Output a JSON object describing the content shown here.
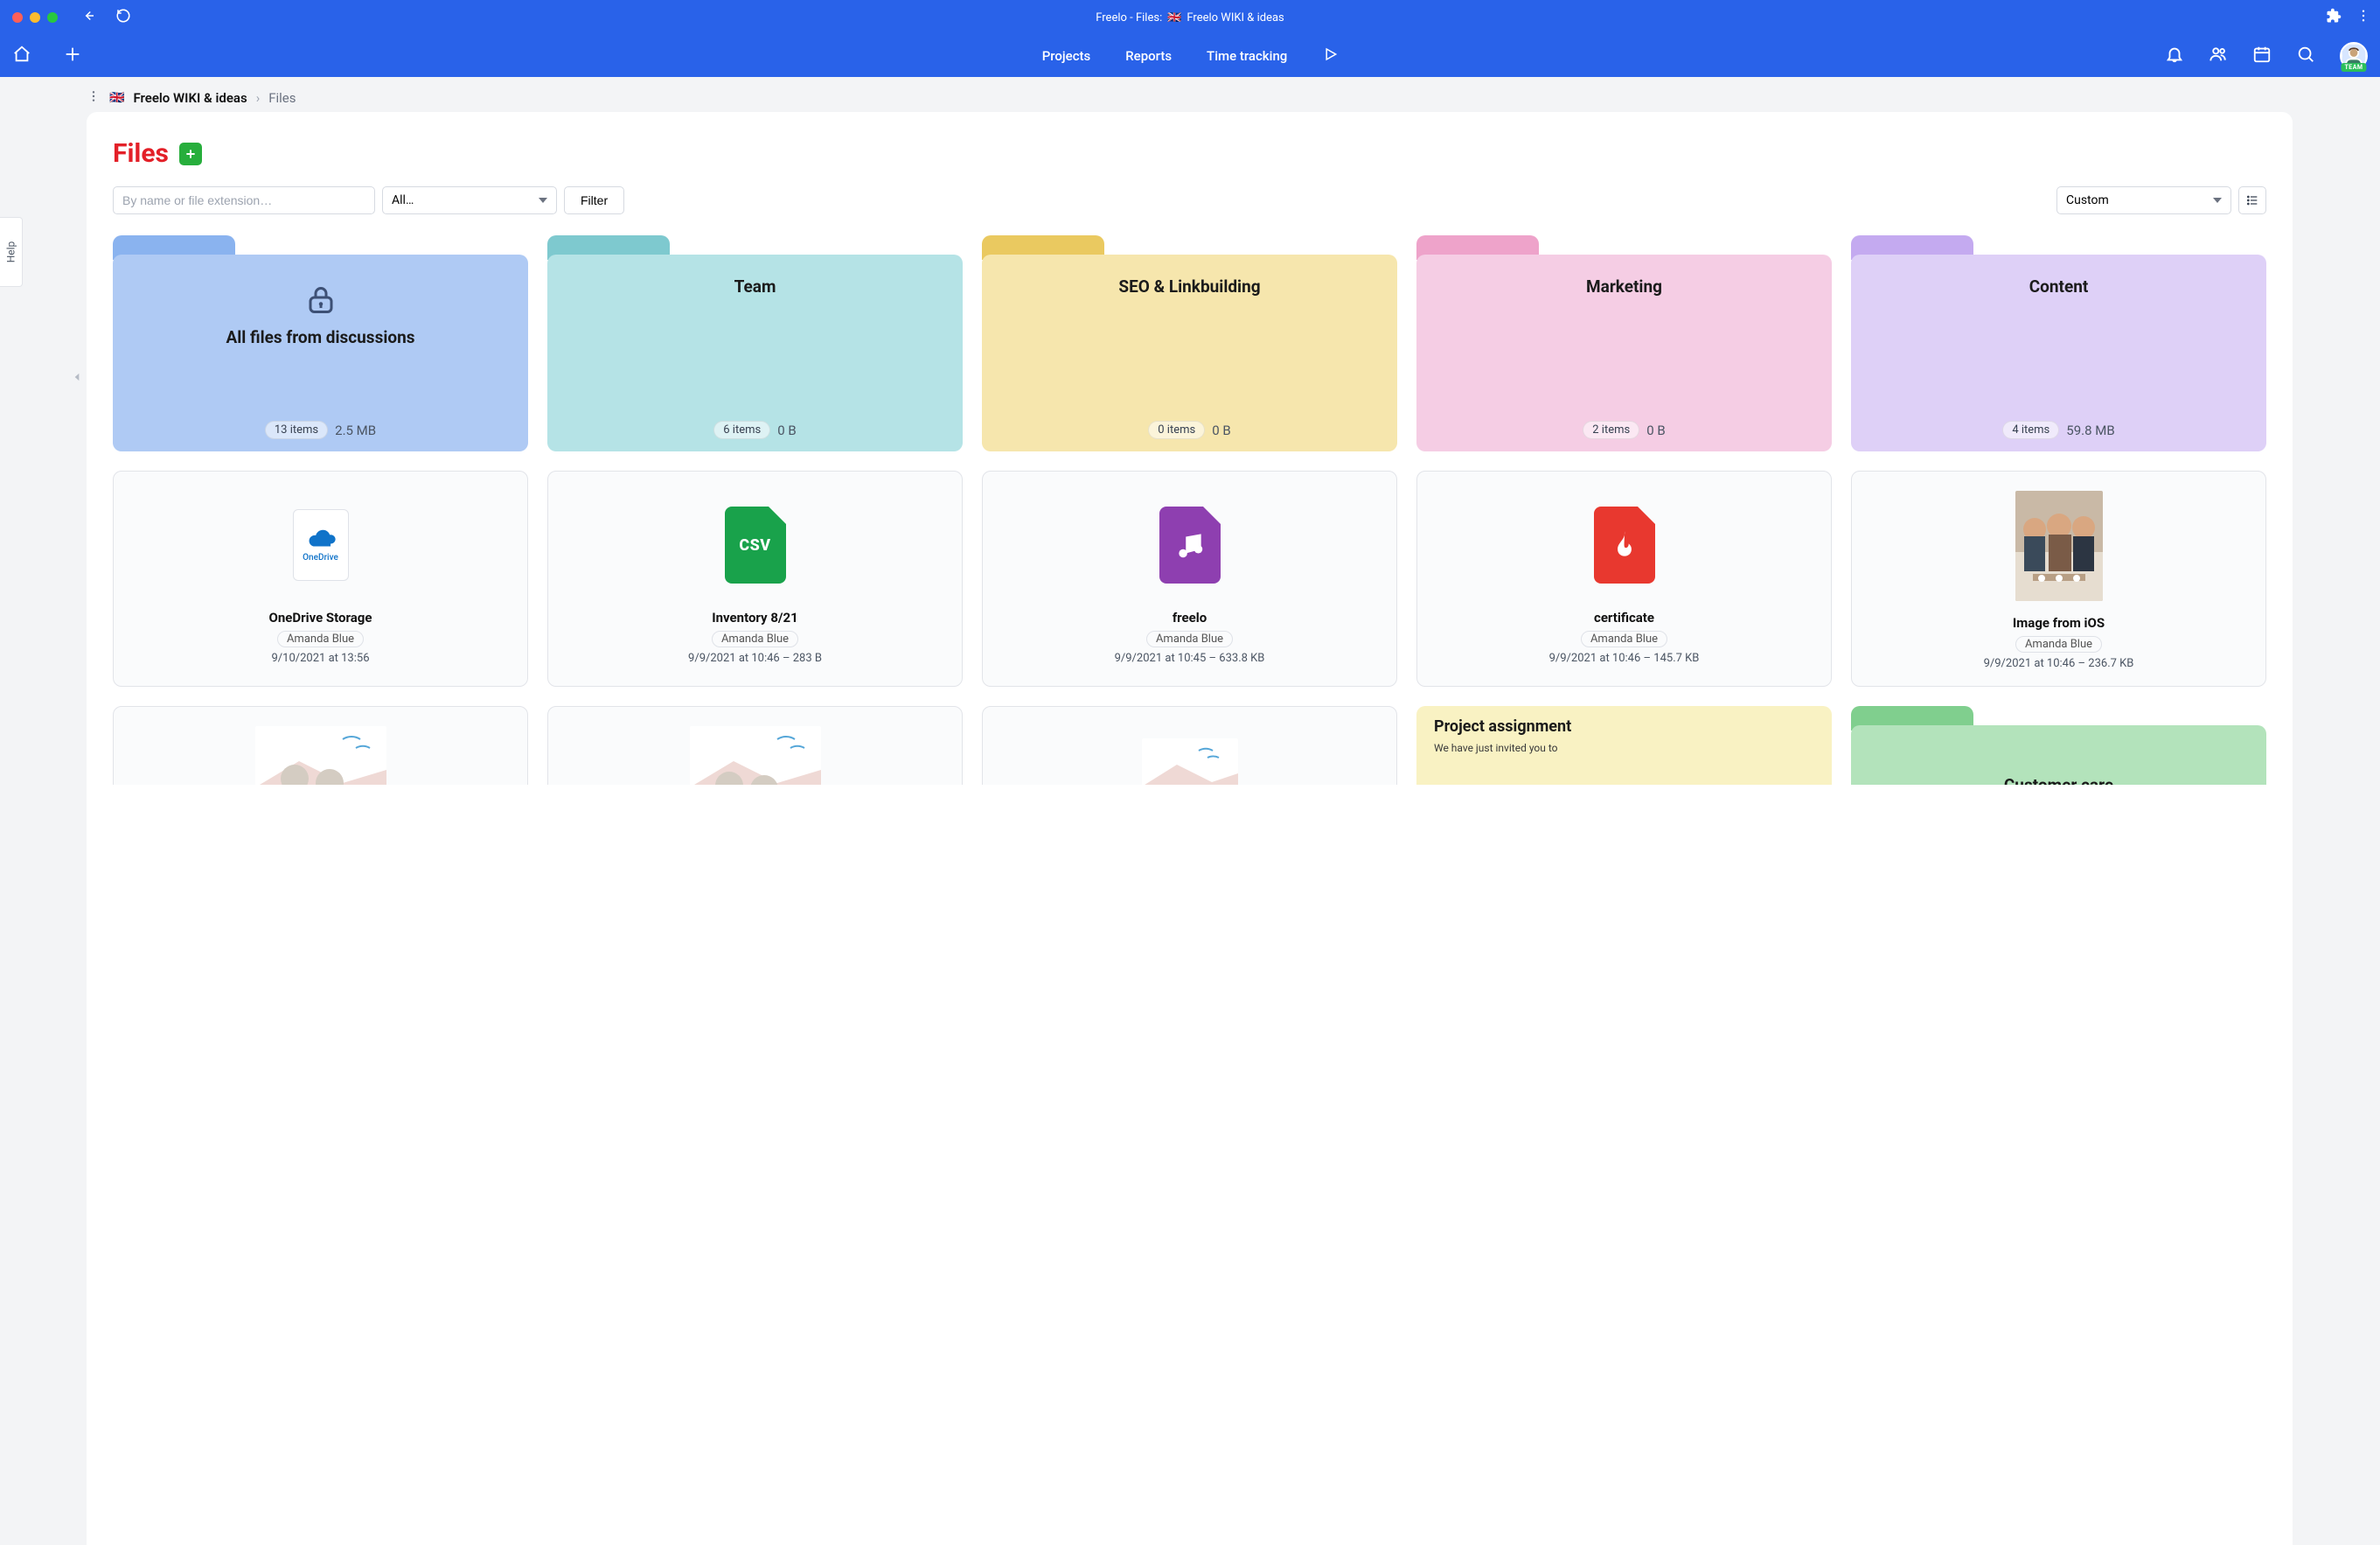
{
  "titlebar": {
    "title_prefix": "Freelo - Files:",
    "project_flag": "🇬🇧",
    "project_name": "Freelo WIKI & ideas"
  },
  "topnav": {
    "items": [
      "Projects",
      "Reports",
      "Time tracking"
    ]
  },
  "avatar": {
    "badge": "TEAM"
  },
  "help_tab": "Help",
  "breadcrumb": {
    "flag": "🇬🇧",
    "project": "Freelo WIKI & ideas",
    "sep": "›",
    "current": "Files"
  },
  "panel": {
    "title": "Files",
    "search_placeholder": "By name or file extension…",
    "type_select": "All…",
    "filter_btn": "Filter",
    "sort_select": "Custom"
  },
  "folders": [
    {
      "title": "All files from discussions",
      "items": "13 items",
      "size": "2.5 MB",
      "variant": "blue",
      "locked": true
    },
    {
      "title": "Team",
      "items": "6 items",
      "size": "0 B",
      "variant": "teal"
    },
    {
      "title": "SEO & Linkbuilding",
      "items": "0 items",
      "size": "0 B",
      "variant": "yellow"
    },
    {
      "title": "Marketing",
      "items": "2 items",
      "size": "0 B",
      "variant": "pink"
    },
    {
      "title": "Content",
      "items": "4 items",
      "size": "59.8 MB",
      "variant": "purple"
    }
  ],
  "files": [
    {
      "name": "OneDrive Storage",
      "author": "Amanda Blue",
      "meta": "9/10/2021 at 13:56",
      "kind": "onedrive"
    },
    {
      "name": "Inventory 8/21",
      "author": "Amanda Blue",
      "meta": "9/9/2021 at 10:46 – 283 B",
      "kind": "csv"
    },
    {
      "name": "freelo",
      "author": "Amanda Blue",
      "meta": "9/9/2021 at 10:45 – 633.8 KB",
      "kind": "audio"
    },
    {
      "name": "certificate",
      "author": "Amanda Blue",
      "meta": "9/9/2021 at 10:46 – 145.7 KB",
      "kind": "pdf"
    },
    {
      "name": "Image from iOS",
      "author": "Amanda Blue",
      "meta": "9/9/2021 at 10:46 – 236.7 KB",
      "kind": "photo"
    }
  ],
  "bottom_row": {
    "note": {
      "title": "Project assignment",
      "sub": "We have just invited you to"
    },
    "folder": {
      "title": "Customer care"
    }
  },
  "icons": {
    "csv_label": "CSV",
    "onedrive_label": "OneDrive"
  }
}
